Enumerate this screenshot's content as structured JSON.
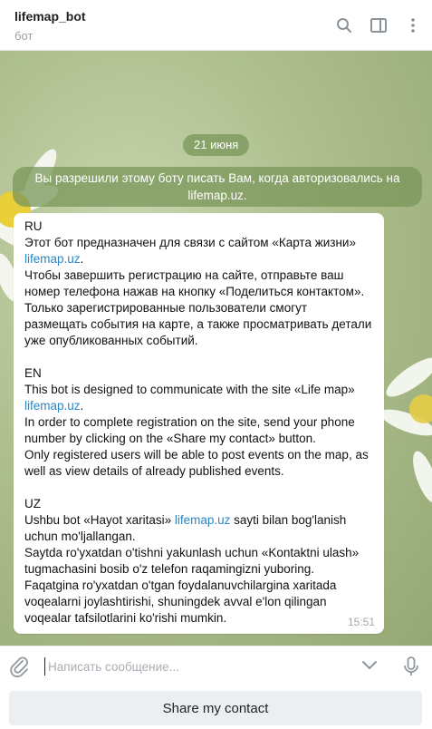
{
  "header": {
    "title": "lifemap_bot",
    "subtitle": "бот"
  },
  "icons": {
    "search": "search-icon",
    "sidebar": "sidebar-icon",
    "more": "more-vertical-icon",
    "attach": "paperclip-icon",
    "chevron": "chevron-down-icon",
    "mic": "microphone-icon"
  },
  "chat": {
    "date": "21 июня",
    "service_message": "Вы разрешили этому боту писать Вам, когда авторизовались на lifemap.uz.",
    "message": {
      "ru_title": "RU",
      "ru_line1": "Этот бот предназначен для связи с сайтом «Карта жизни»",
      "ru_link": "lifemap.uz",
      "ru_after_link": ".",
      "ru_line2": "Чтобы завершить регистрацию на сайте, отправьте ваш номер телефона нажав на кнопку «Поделиться контактом».",
      "ru_line3": "Только зарегистрированные пользователи смогут размещать события на карте, а также просматривать детали уже опубликованных событий.",
      "en_title": "EN",
      "en_line1": "This bot is designed to communicate with the site «Life map»",
      "en_link": "lifemap.uz",
      "en_after_link": ".",
      "en_line2": "In order to complete registration on the site, send your phone number by clicking on the «Share my contact» button.",
      "en_line3": "Only registered users will be able to post events on the map, as well as view details of already published events.",
      "uz_title": "UZ",
      "uz_before_link": "Ushbu bot «Hayot xaritasi» ",
      "uz_link": "lifemap.uz",
      "uz_after_link": " sayti bilan bog'lanish uchun mo'ljallangan.",
      "uz_line2": "Saytda ro'yxatdan o'tishni yakunlash uchun «Kontaktni ulash» tugmachasini bosib o'z telefon raqamingizni yuboring.",
      "uz_line3": "Faqatgina ro'yxatdan o'tgan foydalanuvchilargina xaritada voqealarni joylashtirishi, shuningdek avval e'lon qilingan voqealar tafsilotlarini ko'rishi mumkin.",
      "time": "15:51"
    }
  },
  "composer": {
    "placeholder": "Написать сообщение..."
  },
  "keyboard": {
    "share_label": "Share my contact"
  },
  "colors": {
    "link": "#2a86c4",
    "service_bg": "#7a965a",
    "bubble_bg": "#ffffff"
  }
}
